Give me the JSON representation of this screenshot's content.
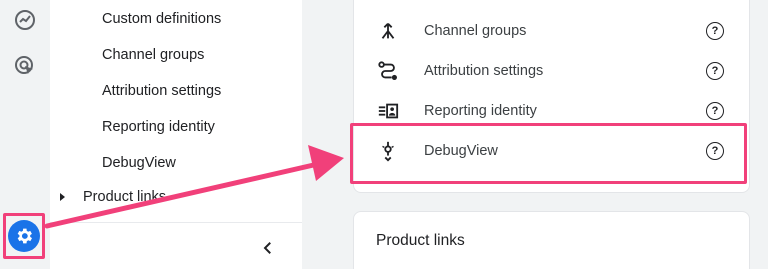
{
  "rail": {
    "icons": [
      "analytics-icon",
      "advertising-icon"
    ],
    "settings_icon": "gear-icon"
  },
  "nav": {
    "items": [
      {
        "label": "Custom definitions"
      },
      {
        "label": "Channel groups"
      },
      {
        "label": "Attribution settings"
      },
      {
        "label": "Reporting identity"
      },
      {
        "label": "DebugView"
      }
    ],
    "section": {
      "label": "Product links"
    },
    "collapse_icon": "chevron-left-icon"
  },
  "content": {
    "rows": [
      {
        "label": "Channel groups",
        "icon": "merge-icon",
        "help": "?"
      },
      {
        "label": "Attribution settings",
        "icon": "route-icon",
        "help": "?"
      },
      {
        "label": "Reporting identity",
        "icon": "identity-icon",
        "help": "?"
      },
      {
        "label": "DebugView",
        "icon": "debug-icon",
        "help": "?"
      }
    ],
    "product_links_title": "Product links"
  },
  "colors": {
    "highlight": "#f1407a",
    "accent": "#1a73e8"
  }
}
